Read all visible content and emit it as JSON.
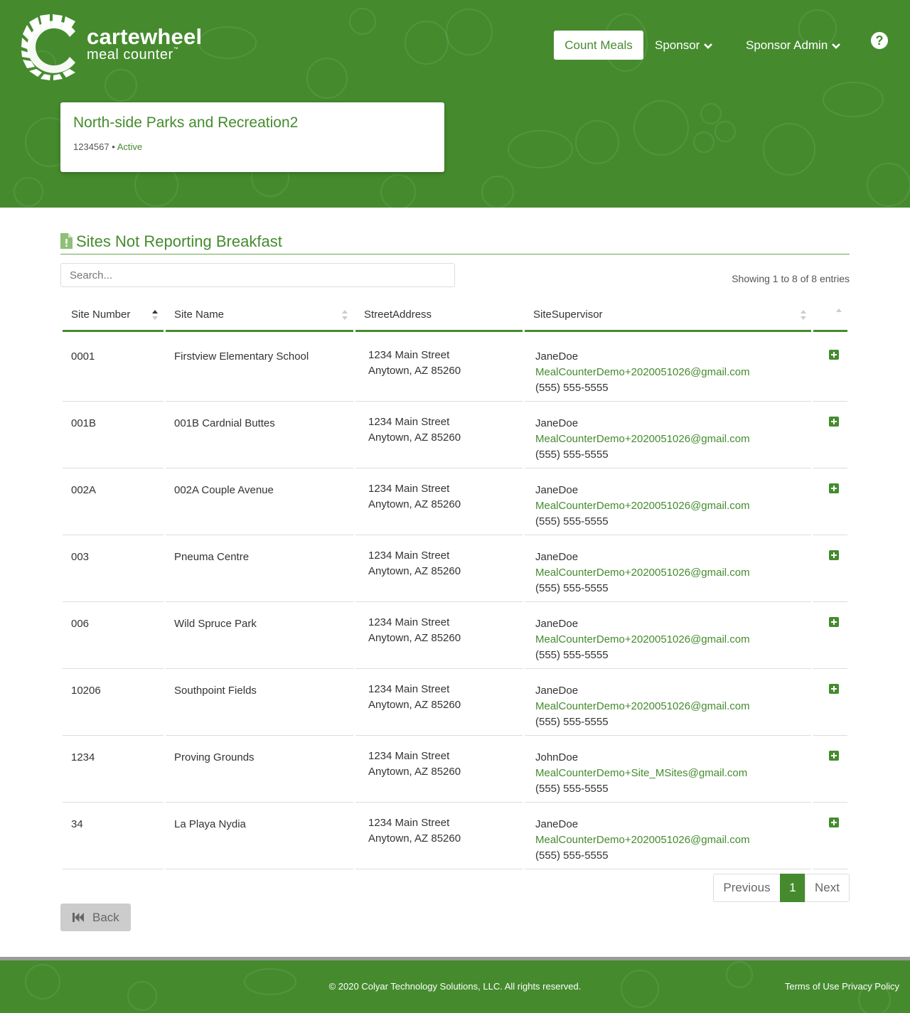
{
  "brand": {
    "name_line1": "cartewheel",
    "name_line2": "meal counter",
    "trademark": "™"
  },
  "nav": {
    "count_meals": "Count Meals",
    "sponsor": "Sponsor",
    "sponsor_admin": "Sponsor Admin",
    "help": "?"
  },
  "org": {
    "name": "North-side Parks and Recreation2",
    "number": "1234567",
    "separator": " • ",
    "status": "Active"
  },
  "section": {
    "title": "Sites Not Reporting Breakfast"
  },
  "search": {
    "placeholder": "Search..."
  },
  "info": {
    "showing": "Showing 1 to 8 of 8 entries"
  },
  "table": {
    "headers": {
      "site_number": "Site Number",
      "site_name": "Site Name",
      "street_address": "StreetAddress",
      "site_supervisor": "SiteSupervisor"
    },
    "rows": [
      {
        "number": "0001",
        "name": "Firstview Elementary School",
        "street": "1234 Main Street",
        "city": "Anytown, AZ 85260",
        "supervisor": "JaneDoe",
        "email": "MealCounterDemo+2020051026@gmail.com",
        "phone": "(555) 555-5555"
      },
      {
        "number": "001B",
        "name": "001B Cardnial Buttes",
        "street": "1234 Main Street",
        "city": "Anytown, AZ 85260",
        "supervisor": "JaneDoe",
        "email": "MealCounterDemo+2020051026@gmail.com",
        "phone": "(555) 555-5555"
      },
      {
        "number": "002A",
        "name": "002A Couple Avenue",
        "street": "1234 Main Street",
        "city": "Anytown, AZ 85260",
        "supervisor": "JaneDoe",
        "email": "MealCounterDemo+2020051026@gmail.com",
        "phone": "(555) 555-5555"
      },
      {
        "number": "003",
        "name": "Pneuma Centre",
        "street": "1234 Main Street",
        "city": "Anytown, AZ 85260",
        "supervisor": "JaneDoe",
        "email": "MealCounterDemo+2020051026@gmail.com",
        "phone": "(555) 555-5555"
      },
      {
        "number": "006",
        "name": "Wild Spruce Park",
        "street": "1234 Main Street",
        "city": "Anytown, AZ 85260",
        "supervisor": "JaneDoe",
        "email": "MealCounterDemo+2020051026@gmail.com",
        "phone": "(555) 555-5555"
      },
      {
        "number": "10206",
        "name": "Southpoint Fields",
        "street": "1234 Main Street",
        "city": "Anytown, AZ 85260",
        "supervisor": "JaneDoe",
        "email": "MealCounterDemo+2020051026@gmail.com",
        "phone": "(555) 555-5555"
      },
      {
        "number": "1234",
        "name": "Proving Grounds",
        "street": "1234 Main Street",
        "city": "Anytown, AZ 85260",
        "supervisor": "JohnDoe",
        "email": "MealCounterDemo+Site_MSites@gmail.com",
        "phone": "(555) 555-5555"
      },
      {
        "number": "34",
        "name": "La Playa Nydia",
        "street": "1234 Main Street",
        "city": "Anytown, AZ 85260",
        "supervisor": "JaneDoe",
        "email": "MealCounterDemo+2020051026@gmail.com",
        "phone": "(555) 555-5555"
      }
    ]
  },
  "pagination": {
    "previous": "Previous",
    "current": "1",
    "next": "Next"
  },
  "back": {
    "label": "Back"
  },
  "footer": {
    "copyright": "© 2020 Colyar Technology Solutions, LLC. All rights reserved.",
    "terms": "Terms of Use",
    "privacy": "Privacy Policy"
  },
  "colors": {
    "brand_green": "#458b2e",
    "light_green_rule": "#6aa84f",
    "back_button_gray": "#cccccc",
    "footer_strip_gray": "#9b9b9b"
  },
  "icons": {
    "logo": "cartwheel-logo-icon",
    "dropdown": "chevron-down-icon",
    "help": "question-circle-icon",
    "section": "file-alert-icon",
    "sort": "sort-icon",
    "expand": "plus-square-icon",
    "back": "fast-backward-icon"
  }
}
